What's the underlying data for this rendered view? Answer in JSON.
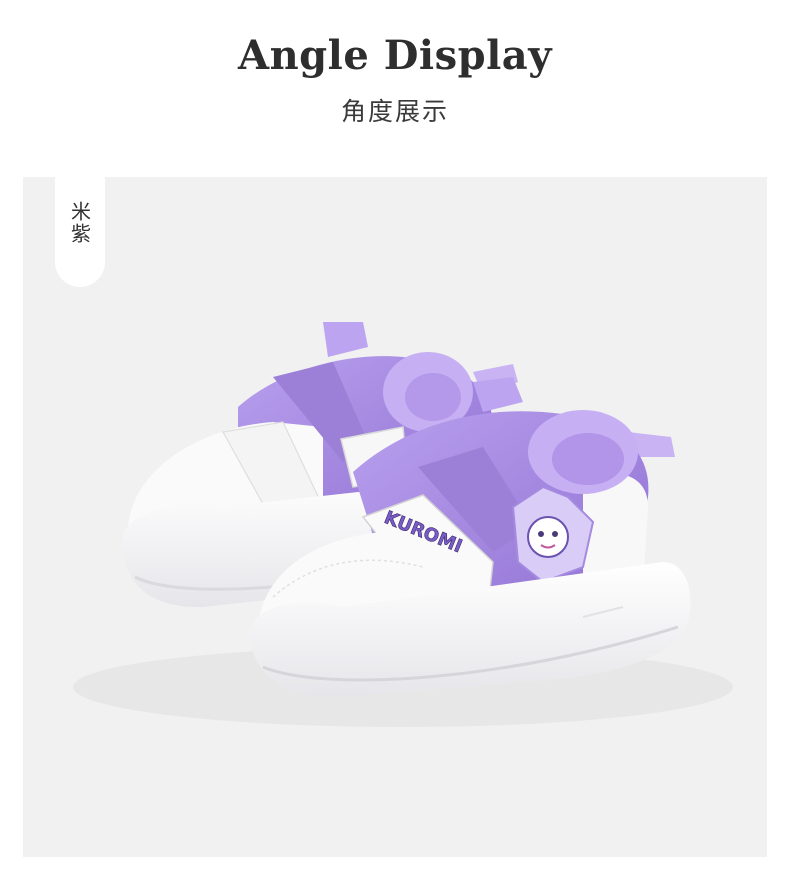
{
  "header": {
    "title": "Angle Display",
    "subtitle": "角度展示"
  },
  "product_photo": {
    "color_label": "米紫",
    "strap_logo_text": "KUROMI",
    "colors": {
      "background": "#f1f1f1",
      "upper_white": "#f8f8f8",
      "accent_purple": "#a78ae0",
      "strap_purple": "#9a7ed6",
      "lining_lavender": "#c2aaf0"
    }
  }
}
